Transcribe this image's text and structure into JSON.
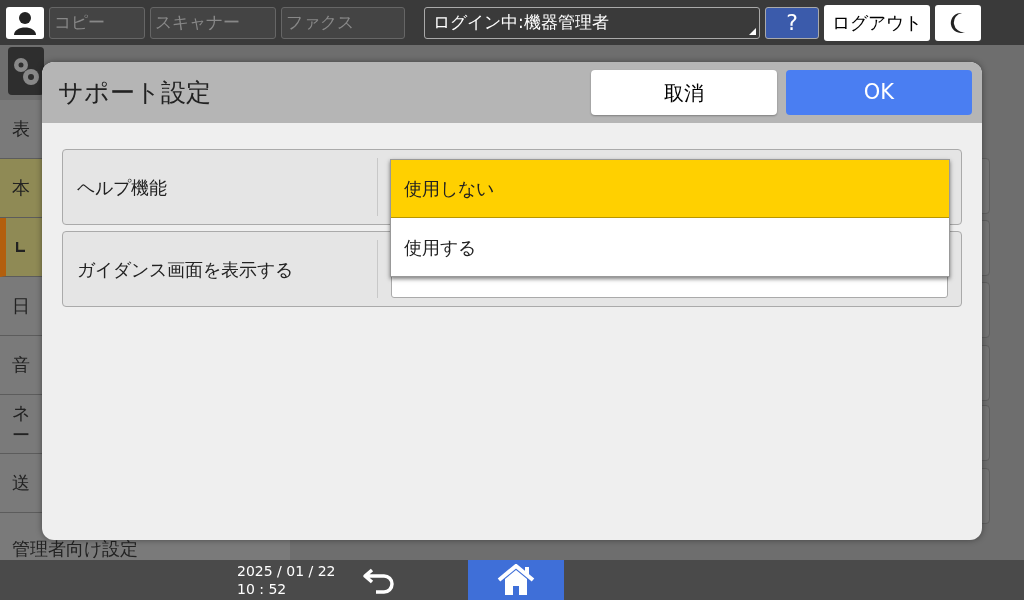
{
  "top_bar": {
    "tabs": [
      {
        "label": "コピー",
        "disabled": true
      },
      {
        "label": "スキャナー",
        "disabled": true
      },
      {
        "label": "ファクス",
        "disabled": true
      }
    ],
    "login": "ログイン中:機器管理者",
    "help_button": "?",
    "logout_button": "ログアウト"
  },
  "sidebar": {
    "items": [
      {
        "kind": "item",
        "lines": [
          "表"
        ],
        "selected": false
      },
      {
        "kind": "item",
        "lines": [
          "本"
        ],
        "selected": true
      },
      {
        "kind": "sub",
        "selected": true
      },
      {
        "kind": "item",
        "lines": [
          "日"
        ],
        "selected": false
      },
      {
        "kind": "item",
        "lines": [
          "音"
        ],
        "selected": false
      },
      {
        "kind": "item",
        "lines": [
          "ネ",
          "ー"
        ],
        "selected": false
      },
      {
        "kind": "item",
        "lines": [
          "送"
        ],
        "selected": false
      },
      {
        "kind": "item",
        "lines": [
          "管理者向け設定"
        ],
        "selected": false
      }
    ]
  },
  "dialog": {
    "title": "サポート設定",
    "cancel_button": "取消",
    "ok_button": "OK",
    "settings": [
      {
        "label": "ヘルプ機能",
        "expanded": true
      },
      {
        "label": "ガイダンス画面を表示する",
        "expanded": false
      }
    ],
    "dropdown_options": [
      {
        "label": "使用しない",
        "selected": true
      },
      {
        "label": "使用する",
        "selected": false
      }
    ]
  },
  "status_bar": {
    "date": "2025 / 01 / 22",
    "time": "10 : 52"
  }
}
